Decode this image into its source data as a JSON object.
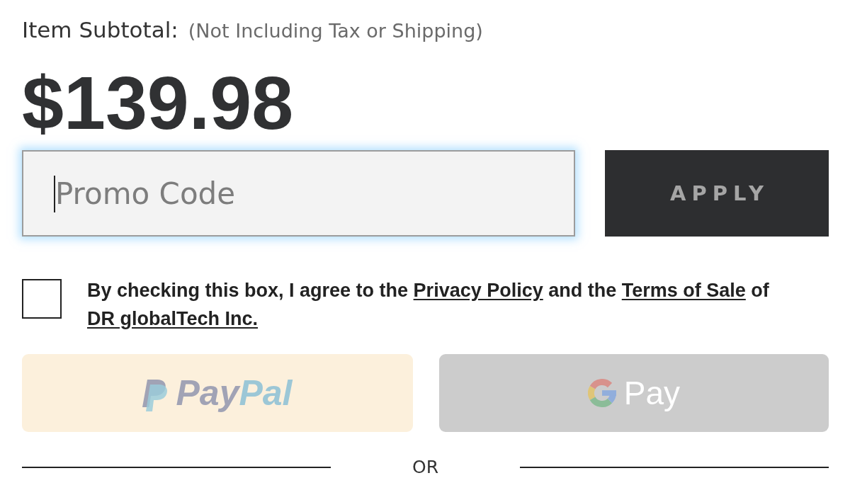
{
  "subtotal": {
    "label": "Item Subtotal:",
    "note": "(Not Including Tax or Shipping)",
    "amount": "$139.98"
  },
  "promo": {
    "placeholder": "Promo Code",
    "focused": true,
    "button": "APPLY"
  },
  "agreement": {
    "checked": false,
    "parts": [
      {
        "kind": "text",
        "text": "By checking this box, I agree to the "
      },
      {
        "kind": "link",
        "text": "Privacy Policy"
      },
      {
        "kind": "text",
        "text": " and the "
      },
      {
        "kind": "link",
        "text": "Terms of Sale"
      },
      {
        "kind": "text",
        "text": " of "
      },
      {
        "kind": "link",
        "text": "DR globalTech Inc."
      }
    ]
  },
  "payment_buttons": [
    {
      "kind": "paypal",
      "disabled": true,
      "wordmark": [
        "Pay",
        "Pal"
      ]
    },
    {
      "kind": "google_pay",
      "disabled": true,
      "label": "Pay"
    }
  ],
  "divider": {
    "label": "OR"
  }
}
